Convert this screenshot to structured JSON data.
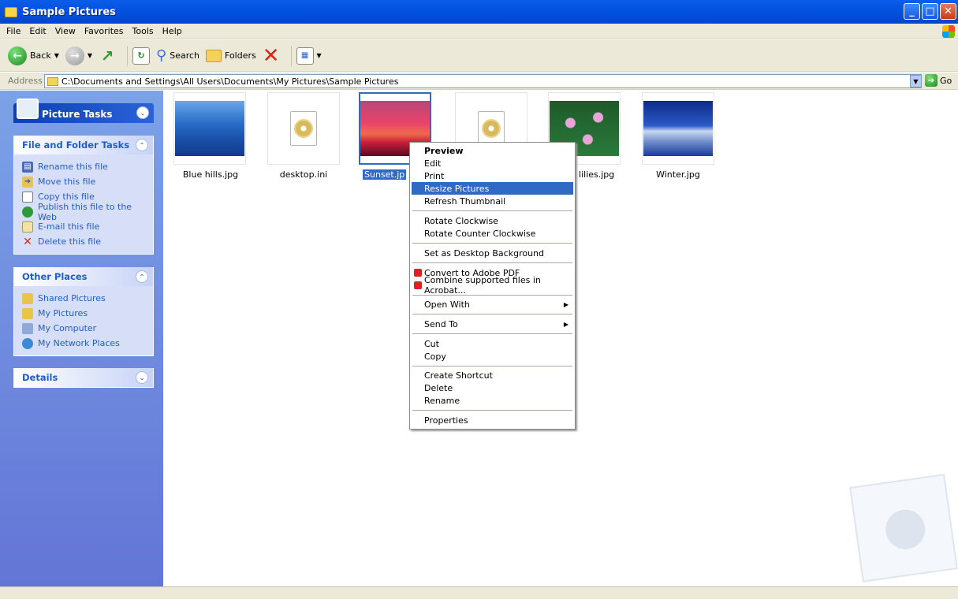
{
  "window": {
    "title": "Sample Pictures",
    "min": "_",
    "max": "□",
    "close": "✕"
  },
  "menubar": [
    "File",
    "Edit",
    "View",
    "Favorites",
    "Tools",
    "Help"
  ],
  "toolbar": {
    "back": "Back",
    "search": "Search",
    "folders": "Folders"
  },
  "address": {
    "label": "Address",
    "path": "C:\\Documents and Settings\\All Users\\Documents\\My Pictures\\Sample Pictures",
    "go": "Go"
  },
  "left": {
    "picture_tasks": "Picture Tasks",
    "file_tasks": {
      "title": "File and Folder Tasks",
      "items": [
        "Rename this file",
        "Move this file",
        "Copy this file",
        "Publish this file to the Web",
        "E-mail this file",
        "Delete this file"
      ]
    },
    "other_places": {
      "title": "Other Places",
      "items": [
        "Shared Pictures",
        "My Pictures",
        "My Computer",
        "My Network Places"
      ]
    },
    "details": "Details"
  },
  "files": [
    {
      "name": "Blue hills.jpg",
      "kind": "image"
    },
    {
      "name": "desktop.ini",
      "kind": "ini"
    },
    {
      "name": "Sunset.jpg",
      "kind": "image",
      "visible": "Sunset.jp",
      "selected": true
    },
    {
      "name": "",
      "kind": "ini"
    },
    {
      "name": "Water lilies.jpg",
      "kind": "image",
      "visible": "r lilies.jpg"
    },
    {
      "name": "Winter.jpg",
      "kind": "image"
    }
  ],
  "context_menu": {
    "items": [
      "Preview",
      "Edit",
      "Print",
      "Resize Pictures",
      "Refresh Thumbnail",
      "Rotate Clockwise",
      "Rotate Counter Clockwise",
      "Set as Desktop Background",
      "Convert to Adobe PDF",
      "Combine supported files in Acrobat...",
      "Open With",
      "Send To",
      "Cut",
      "Copy",
      "Create Shortcut",
      "Delete",
      "Rename",
      "Properties"
    ],
    "highlighted": "Resize Pictures"
  },
  "colors": {
    "selection": "#316ac5",
    "titlebar": "#0253e0",
    "link": "#215dc6"
  }
}
